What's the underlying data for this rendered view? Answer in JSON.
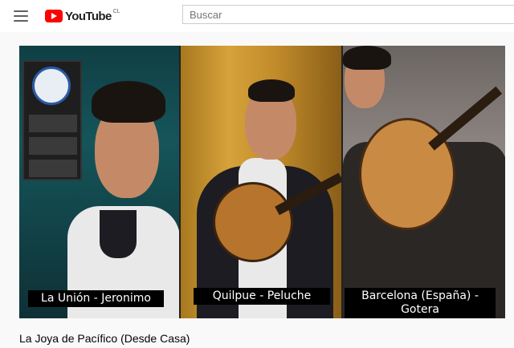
{
  "header": {
    "logo_text": "YouTube",
    "logo_country": "CL",
    "search_placeholder": "Buscar"
  },
  "video": {
    "title": "La Joya de Pacífico (Desde Casa)",
    "tiles": [
      {
        "caption": "La Unión - Jeronimo"
      },
      {
        "caption": "Quilpue - Peluche"
      },
      {
        "caption": "Barcelona (España) - Gotera"
      }
    ]
  },
  "icons": {
    "menu": "hamburger-menu-icon",
    "logo": "youtube-play-icon"
  },
  "colors": {
    "brand_red": "#ff0000",
    "header_bg": "#ffffff",
    "page_bg": "#f9f9f9"
  }
}
